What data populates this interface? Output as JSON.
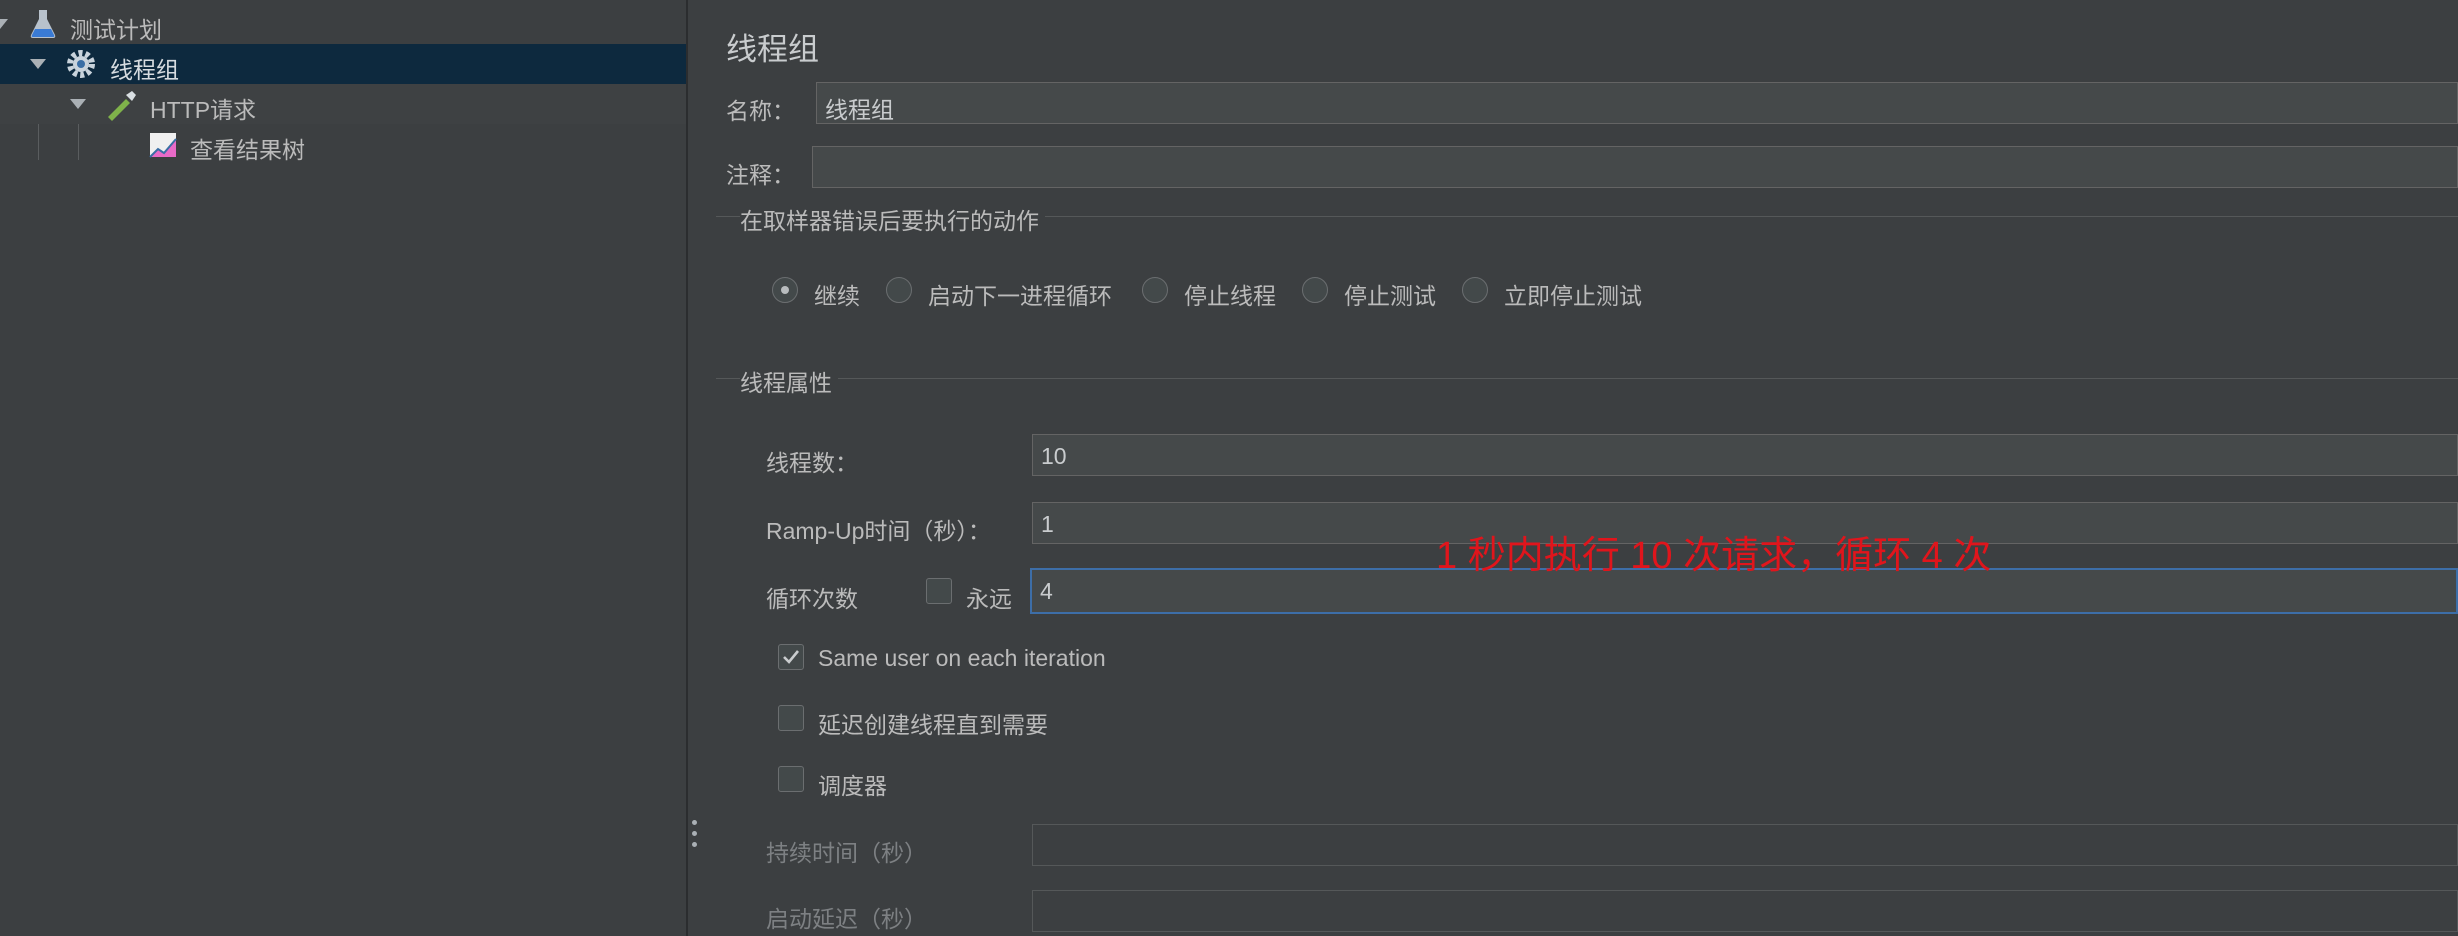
{
  "tree": {
    "items": [
      {
        "label": "测试计划",
        "icon": "flask-icon"
      },
      {
        "label": "线程组",
        "icon": "gear-icon"
      },
      {
        "label": "HTTP请求",
        "icon": "pipette-icon"
      },
      {
        "label": "查看结果树",
        "icon": "chart-icon"
      }
    ]
  },
  "panel": {
    "title": "线程组",
    "name_label": "名称：",
    "name_value": "线程组",
    "comment_label": "注释：",
    "comment_value": "",
    "error_group_title": "在取样器错误后要执行的动作",
    "error_actions": [
      {
        "label": "继续",
        "checked": true
      },
      {
        "label": "启动下一进程循环",
        "checked": false
      },
      {
        "label": "停止线程",
        "checked": false
      },
      {
        "label": "停止测试",
        "checked": false
      },
      {
        "label": "立即停止测试",
        "checked": false
      }
    ],
    "thread_group_title": "线程属性",
    "threads_label": "线程数：",
    "threads_value": "10",
    "rampup_label": "Ramp-Up时间（秒）：",
    "rampup_value": "1",
    "loop_label": "循环次数",
    "forever_label": "永远",
    "forever_checked": false,
    "loop_value": "4",
    "same_user_label": "Same user on each iteration",
    "same_user_checked": true,
    "delay_create_label": "延迟创建线程直到需要",
    "delay_create_checked": false,
    "scheduler_label": "调度器",
    "scheduler_checked": false,
    "duration_label": "持续时间（秒）",
    "duration_value": "",
    "startup_delay_label": "启动延迟（秒）",
    "startup_delay_value": ""
  },
  "annotation": "1 秒内执行 10 次请求，循环 4 次",
  "colors": {
    "background": "#3c3f41",
    "selection": "#0d293e",
    "focus_border": "#3d6ea8",
    "annotation": "#e0151c"
  }
}
